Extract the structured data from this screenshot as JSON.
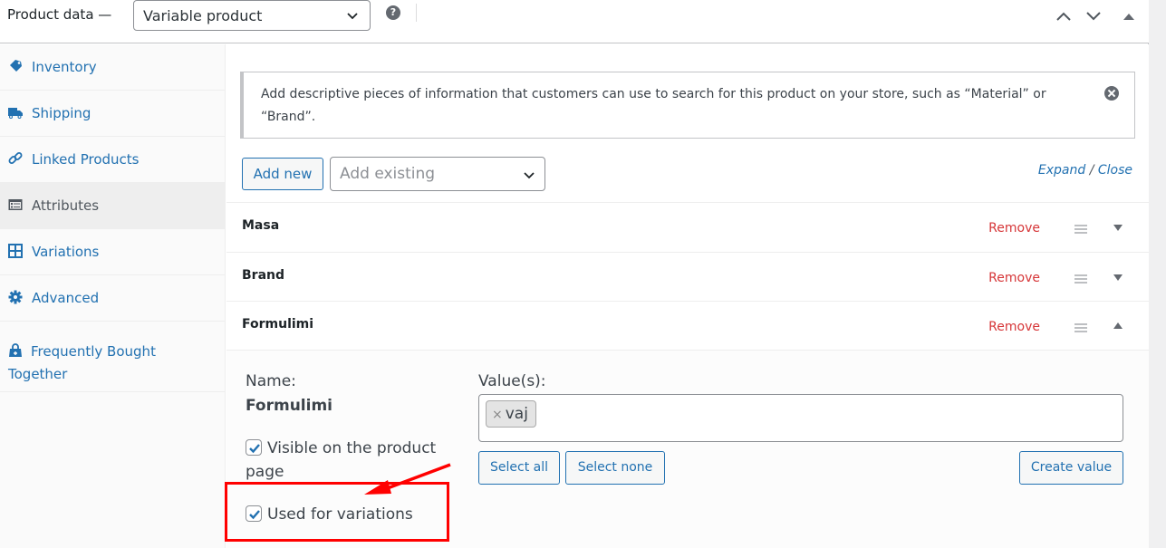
{
  "header": {
    "title": "Product data —",
    "product_type": "Variable product",
    "help_icon": "question-circle-icon",
    "controls": [
      "move-up-icon",
      "move-down-icon",
      "collapse-triangle-icon"
    ]
  },
  "sidebar": {
    "items": [
      {
        "label": "Inventory",
        "icon": "tag-icon",
        "active": false
      },
      {
        "label": "Shipping",
        "icon": "truck-icon",
        "active": false
      },
      {
        "label": "Linked Products",
        "icon": "link-icon",
        "active": false
      },
      {
        "label": "Attributes",
        "icon": "list-card-icon",
        "active": true
      },
      {
        "label": "Variations",
        "icon": "grid-icon",
        "active": false
      },
      {
        "label": "Advanced",
        "icon": "gear-icon",
        "active": false
      },
      {
        "label": "Frequently Bought Together",
        "icon": "shopping-bag-icon",
        "active": false
      }
    ]
  },
  "notice": {
    "text": "Add descriptive pieces of information that customers can use to search for this product on your store, such as “Material” or “Brand”."
  },
  "toolbar": {
    "add_new": "Add new",
    "add_existing_placeholder": "Add existing",
    "expand": "Expand",
    "separator": "/",
    "close": "Close"
  },
  "attributes": [
    {
      "name": "Masa",
      "remove": "Remove",
      "expanded": false
    },
    {
      "name": "Brand",
      "remove": "Remove",
      "expanded": false
    },
    {
      "name": "Formulimi",
      "remove": "Remove",
      "expanded": true
    }
  ],
  "expanded_attribute": {
    "name_label": "Name:",
    "name_value": "Formulimi",
    "values_label": "Value(s):",
    "values": [
      "vaj"
    ],
    "tag_remove": "×",
    "visible_label": "Visible on the product page",
    "visible_checked": true,
    "variations_label": "Used for variations",
    "variations_checked": true,
    "select_all": "Select all",
    "select_none": "Select none",
    "create_value": "Create value"
  },
  "annotation": {
    "color": "#ff0000",
    "target": "Used for variations"
  }
}
